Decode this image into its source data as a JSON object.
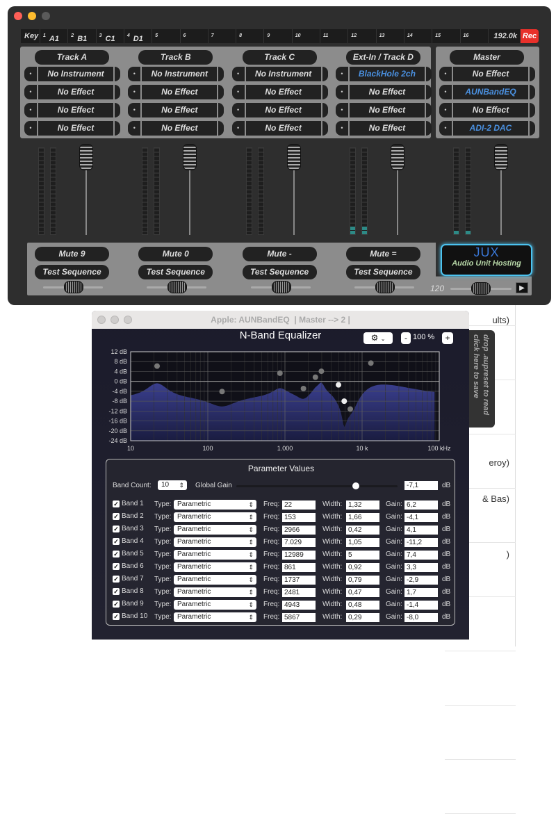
{
  "background_window": {
    "fragments": [
      "ults)",
      "eroy)",
      "& Bas)",
      ")"
    ]
  },
  "main_window": {
    "key_row": {
      "key_label": "Key",
      "cells": [
        {
          "num": "1",
          "note": "A1"
        },
        {
          "num": "2",
          "note": "B1"
        },
        {
          "num": "3",
          "note": "C1"
        },
        {
          "num": "4",
          "note": "D1"
        },
        {
          "num": "5",
          "note": ""
        },
        {
          "num": "6",
          "note": ""
        },
        {
          "num": "7",
          "note": ""
        },
        {
          "num": "8",
          "note": ""
        },
        {
          "num": "9",
          "note": ""
        },
        {
          "num": "10",
          "note": ""
        },
        {
          "num": "11",
          "note": ""
        },
        {
          "num": "12",
          "note": ""
        },
        {
          "num": "13",
          "note": ""
        },
        {
          "num": "14",
          "note": ""
        },
        {
          "num": "15",
          "note": ""
        },
        {
          "num": "16",
          "note": ""
        }
      ],
      "sample_rate": "192.0k",
      "rec_label": "Rec"
    },
    "tracks": [
      {
        "name": "Track A",
        "slots": [
          "No Instrument",
          "No Effect",
          "No Effect",
          "No Effect"
        ],
        "active": [
          false,
          false,
          false,
          false
        ],
        "mute": "Mute  9",
        "test": "Test Sequence",
        "meter_level": 0
      },
      {
        "name": "Track B",
        "slots": [
          "No Instrument",
          "No Effect",
          "No Effect",
          "No Effect"
        ],
        "active": [
          false,
          false,
          false,
          false
        ],
        "mute": "Mute  0",
        "test": "Test Sequence",
        "meter_level": 0
      },
      {
        "name": "Track C",
        "slots": [
          "No Instrument",
          "No Effect",
          "No Effect",
          "No Effect"
        ],
        "active": [
          false,
          false,
          false,
          false
        ],
        "mute": "Mute  -",
        "test": "Test Sequence",
        "meter_level": 0
      },
      {
        "name": "Ext-In / Track D",
        "slots": [
          "BlackHole 2ch",
          "No Effect",
          "No Effect",
          "No Effect"
        ],
        "active": [
          true,
          false,
          false,
          false
        ],
        "mute": "Mute  =",
        "test": "Test Sequence",
        "meter_level": 2
      }
    ],
    "master": {
      "name": "Master",
      "slots": [
        "No Effect",
        "AUNBandEQ",
        "No Effect",
        "ADI-2 DAC"
      ],
      "active": [
        false,
        true,
        false,
        true
      ],
      "meter_level": 1
    },
    "logo": {
      "text": "JUX",
      "subtitle": "Audio Unit Hosting"
    },
    "tempo": "120",
    "play_icon": "play-icon",
    "colors": {
      "rec": "#e8302a",
      "active_slot": "#4a90e0",
      "meter_lit": "#2d8a86",
      "logo_glow": "#4cc3f0"
    }
  },
  "eq_window": {
    "title": "Apple: AUNBandEQ  | Master --> 2 |",
    "heading": "N-Band Equalizer",
    "zoom": "100 %",
    "zoom_minus": "-",
    "zoom_plus": "+",
    "side_tab": [
      "drop .aupreset to read",
      "click here to save"
    ],
    "chart_data": {
      "type": "area",
      "x_scale": "log",
      "xlim": [
        10,
        100000
      ],
      "ylim": [
        -24,
        12
      ],
      "y_ticks": [
        "12 dB",
        "8 dB",
        "4 dB",
        "0 dB",
        "-4 dB",
        "-8 dB",
        "-12 dB",
        "-16 dB",
        "-20 dB",
        "-24 dB"
      ],
      "y_tick_values": [
        12,
        8,
        4,
        0,
        -4,
        -8,
        -12,
        -16,
        -20,
        -24
      ],
      "x_ticks": [
        "10",
        "100",
        "1.000",
        "10 k",
        "100 kHz"
      ],
      "x_tick_values": [
        10,
        100,
        1000,
        10000,
        100000
      ],
      "grid": true,
      "curve_color": "#3a3f8f",
      "selected_bands": [
        9,
        10
      ]
    },
    "params": {
      "title": "Parameter Values",
      "band_count_label": "Band Count:",
      "band_count": "10",
      "global_gain_label": "Global Gain",
      "global_gain": "-7,1",
      "global_gain_value": -7.1,
      "global_gain_range": [
        -96,
        24
      ],
      "db": "dB",
      "type_label": "Type:",
      "freq_label": "Freq:",
      "width_label": "Width:",
      "gain_label": "Gain:",
      "bands": [
        {
          "label": "Band 1",
          "type": "Parametric",
          "freq": "22",
          "width": "1,32",
          "gain": "6,2",
          "enabled": true
        },
        {
          "label": "Band 2",
          "type": "Parametric",
          "freq": "153",
          "width": "1,66",
          "gain": "-4,1",
          "enabled": true
        },
        {
          "label": "Band 3",
          "type": "Parametric",
          "freq": "2966",
          "width": "0,42",
          "gain": "4,1",
          "enabled": true
        },
        {
          "label": "Band 4",
          "type": "Parametric",
          "freq": "7.029",
          "width": "1,05",
          "gain": "-11,2",
          "enabled": true
        },
        {
          "label": "Band 5",
          "type": "Parametric",
          "freq": "12989",
          "width": "5",
          "gain": "7,4",
          "enabled": true
        },
        {
          "label": "Band 6",
          "type": "Parametric",
          "freq": "861",
          "width": "0,92",
          "gain": "3,3",
          "enabled": true
        },
        {
          "label": "Band 7",
          "type": "Parametric",
          "freq": "1737",
          "width": "0,79",
          "gain": "-2,9",
          "enabled": true
        },
        {
          "label": "Band 8",
          "type": "Parametric",
          "freq": "2481",
          "width": "0,47",
          "gain": "1,7",
          "enabled": true
        },
        {
          "label": "Band 9",
          "type": "Parametric",
          "freq": "4943",
          "width": "0,48",
          "gain": "-1,4",
          "enabled": true
        },
        {
          "label": "Band 10",
          "type": "Parametric",
          "freq": "5867",
          "width": "0,29",
          "gain": "-8,0",
          "enabled": true
        }
      ]
    }
  }
}
